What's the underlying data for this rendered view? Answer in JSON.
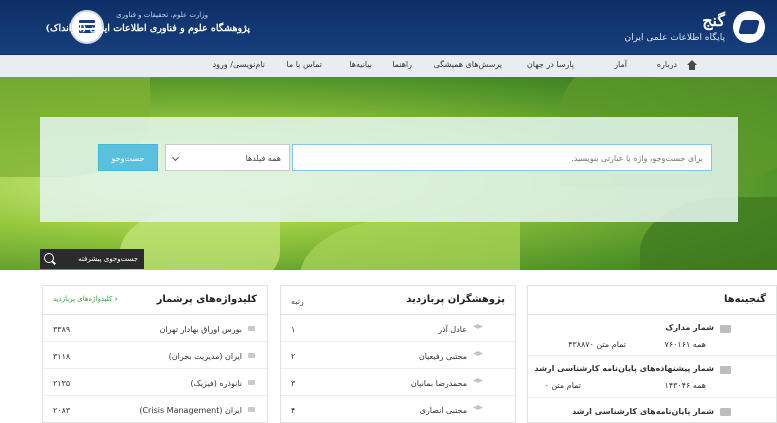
{
  "header": {
    "brand_name": "گنج",
    "brand_subtitle": "پایگاه اطلاعات علمی ایران",
    "org_top": "وزارت علوم، تحقیقات و فناوری",
    "org_name": "پژوهشگاه علوم و فناوری اطلاعات ایران (ایرانداک)"
  },
  "nav": {
    "items": [
      "درباره",
      "آمار",
      "پارسا در جهان",
      "پرسش‌های همیشگی",
      "راهنما",
      "بیانیه‌ها",
      "تماس با ما",
      "نام‌نویسی/ ورود"
    ]
  },
  "search": {
    "placeholder": "برای جست‌وجو، واژه یا عبارتی بنویسید.",
    "field_selected": "همه فیلدها",
    "button_label": "جست‌وجو",
    "advanced_label": "جست‌وجوی پیشرفته"
  },
  "treasures": {
    "title": "گنجینه‌ها",
    "items": [
      {
        "label": "شمار مدارک",
        "left": "تمام متن ۴۳۸۸۷۰",
        "right": "همه ۷۶۰۱۶۱"
      },
      {
        "label": "شمار پیشنهاده‌های پایان‌نامه کارشناسی ارشد",
        "left": "تمام متن ۰",
        "right": "همه ۱۴۳۰۴۶"
      },
      {
        "label": "شمار پایان‌نامه‌های کارشناسی ارشد",
        "left": "",
        "right": ""
      }
    ]
  },
  "researchers": {
    "title": "پژوهشگران پربازدید",
    "rank_header": "رتبه",
    "rows": [
      {
        "name": "عادل آذر",
        "rank": "۱"
      },
      {
        "name": "مجتبی رفیعیان",
        "rank": "۲"
      },
      {
        "name": "محمدرضا بمانیان",
        "rank": "۳"
      },
      {
        "name": "مجتبی انصاری",
        "rank": "۴"
      }
    ]
  },
  "keywords": {
    "title": "کلیدواژه‌های پرشمار",
    "link": "کلیدواژه‌های پربازدید",
    "rows": [
      {
        "term": "بورس اوراق بهادار تهران",
        "count": "۳۳۸۹"
      },
      {
        "term": "ایران (مدیریت بحران)",
        "count": "۳۱۱۸"
      },
      {
        "term": "نانوذره (فیزیک)",
        "count": "۲۱۳۵"
      },
      {
        "term": "ایران (Crisis Management)",
        "count": "۲۰۸۳"
      }
    ]
  }
}
